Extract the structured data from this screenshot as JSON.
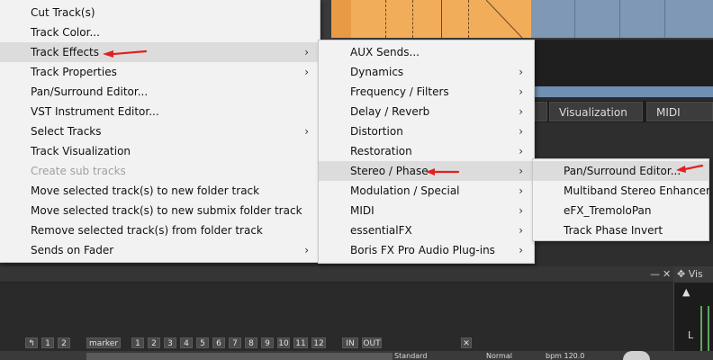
{
  "context_menu": {
    "items": [
      {
        "label": "Cut Track(s)",
        "submenu": false,
        "disabled": false,
        "active": false
      },
      {
        "label": "Track Color...",
        "submenu": false,
        "disabled": false,
        "active": false
      },
      {
        "label": "Track Effects",
        "submenu": true,
        "disabled": false,
        "active": true
      },
      {
        "label": "Track Properties",
        "submenu": true,
        "disabled": false,
        "active": false
      },
      {
        "label": "Pan/Surround Editor...",
        "submenu": false,
        "disabled": false,
        "active": false
      },
      {
        "label": "VST Instrument Editor...",
        "submenu": false,
        "disabled": false,
        "active": false
      },
      {
        "label": "Select Tracks",
        "submenu": true,
        "disabled": false,
        "active": false
      },
      {
        "label": "Track Visualization",
        "submenu": false,
        "disabled": false,
        "active": false
      },
      {
        "label": "Create sub tracks",
        "submenu": false,
        "disabled": true,
        "active": false
      },
      {
        "label": "Move selected track(s) to new folder track",
        "submenu": false,
        "disabled": false,
        "active": false
      },
      {
        "label": "Move selected track(s) to new submix folder track",
        "submenu": false,
        "disabled": false,
        "active": false
      },
      {
        "label": "Remove selected track(s) from folder track",
        "submenu": false,
        "disabled": false,
        "active": false
      },
      {
        "label": "Sends on Fader",
        "submenu": true,
        "disabled": false,
        "active": false
      }
    ]
  },
  "track_effects_menu": {
    "items": [
      {
        "label": "AUX Sends...",
        "submenu": false,
        "active": false
      },
      {
        "label": "Dynamics",
        "submenu": true,
        "active": false
      },
      {
        "label": "Frequency / Filters",
        "submenu": true,
        "active": false
      },
      {
        "label": "Delay / Reverb",
        "submenu": true,
        "active": false
      },
      {
        "label": "Distortion",
        "submenu": true,
        "active": false
      },
      {
        "label": "Restoration",
        "submenu": true,
        "active": false
      },
      {
        "label": "Stereo / Phase",
        "submenu": true,
        "active": true
      },
      {
        "label": "Modulation / Special",
        "submenu": true,
        "active": false
      },
      {
        "label": "MIDI",
        "submenu": true,
        "active": false
      },
      {
        "label": "essentialFX",
        "submenu": true,
        "active": false
      },
      {
        "label": "Boris FX Pro Audio Plug-ins",
        "submenu": true,
        "active": false
      }
    ]
  },
  "stereo_phase_menu": {
    "items": [
      {
        "label": "Pan/Surround Editor...",
        "active": true
      },
      {
        "label": "Multiband Stereo Enhancer...",
        "active": false
      },
      {
        "label": "eFX_TremoloPan",
        "active": false
      },
      {
        "label": "Track Phase Invert",
        "active": false
      }
    ]
  },
  "background": {
    "tabs": [
      "Visualization",
      "MIDI Editor"
    ],
    "marker_label": "marker",
    "track_numbers": [
      "1",
      "2",
      "3",
      "4",
      "5",
      "6",
      "7",
      "8",
      "9",
      "10",
      "11",
      "12"
    ],
    "in_label": "IN",
    "out_label": "OUT",
    "left_group": [
      "1",
      "2"
    ],
    "vis_title": "Vis",
    "level_label": "L",
    "dropdown_standard": "Standard",
    "dropdown_normal": "Normal",
    "bpm_label": "bpm 120.0"
  },
  "colors": {
    "menu_bg": "#f2f2f2",
    "highlight": "#dcdcdc",
    "arrow": "#e02020",
    "clip": "#f2ad5b"
  },
  "icons": {
    "submenu": "chevron-right-icon",
    "pointer": "red-arrow-icon"
  }
}
